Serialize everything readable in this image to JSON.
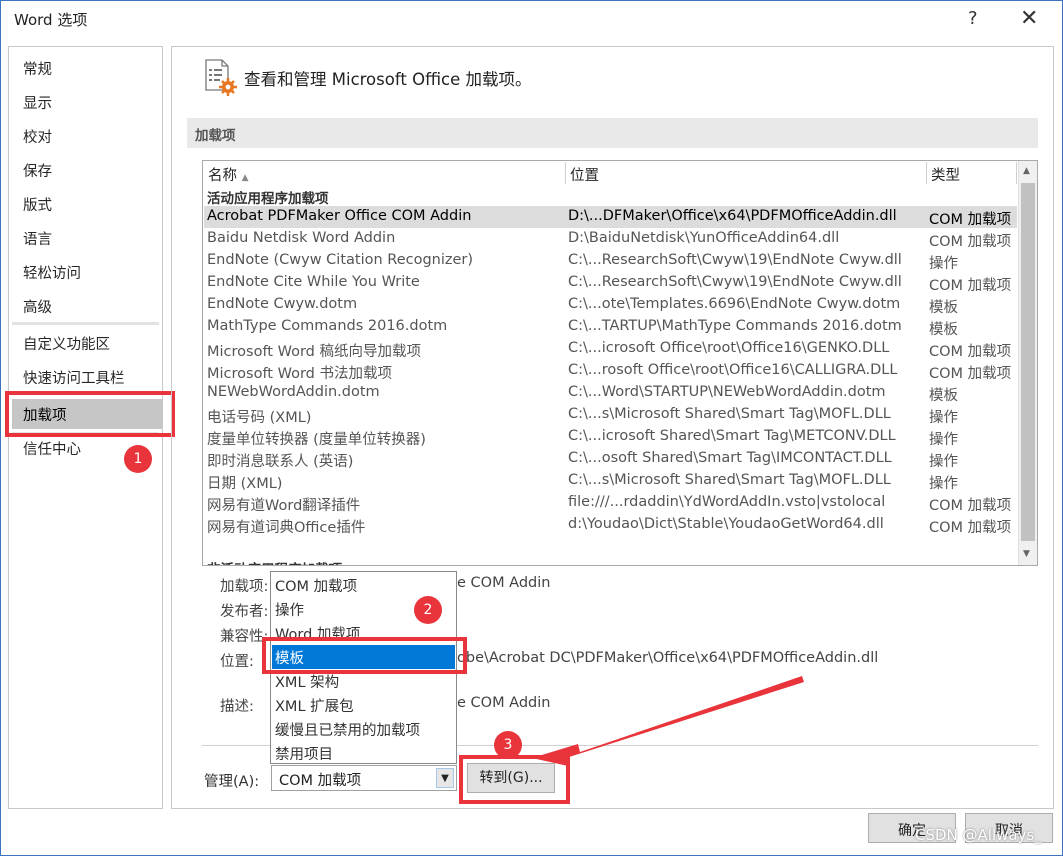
{
  "window": {
    "title": "Word 选项",
    "help": "?",
    "close": "✕"
  },
  "nav": {
    "items": [
      "常规",
      "显示",
      "校对",
      "保存",
      "版式",
      "语言",
      "轻松访问",
      "高级",
      "自定义功能区",
      "快速访问工具栏",
      "加载项",
      "信任中心"
    ],
    "selected": "加载项"
  },
  "header": {
    "heading": "查看和管理 Microsoft Office 加载项。"
  },
  "addins": {
    "section_title": "加载项",
    "columns": {
      "name": "名称",
      "location": "位置",
      "type": "类型"
    },
    "group_active": "活动应用程序加载项",
    "group_inactive": "非活动应用程序加载项",
    "rows": [
      {
        "name": "Acrobat PDFMaker Office COM Addin",
        "location": "D:\\...DFMaker\\Office\\x64\\PDFMOfficeAddin.dll",
        "type": "COM 加载项"
      },
      {
        "name": "Baidu Netdisk Word Addin",
        "location": "D:\\BaiduNetdisk\\YunOfficeAddin64.dll",
        "type": "COM 加载项"
      },
      {
        "name": "EndNote (Cwyw Citation Recognizer)",
        "location": "C:\\...ResearchSoft\\Cwyw\\19\\EndNote Cwyw.dll",
        "type": "操作"
      },
      {
        "name": "EndNote Cite While You Write",
        "location": "C:\\...ResearchSoft\\Cwyw\\19\\EndNote Cwyw.dll",
        "type": "COM 加载项"
      },
      {
        "name": "EndNote Cwyw.dotm",
        "location": "C:\\...ote\\Templates.6696\\EndNote Cwyw.dotm",
        "type": "模板"
      },
      {
        "name": "MathType Commands 2016.dotm",
        "location": "C:\\...TARTUP\\MathType Commands 2016.dotm",
        "type": "模板"
      },
      {
        "name": "Microsoft Word 稿纸向导加载项",
        "location": "C:\\...icrosoft Office\\root\\Office16\\GENKO.DLL",
        "type": "COM 加载项"
      },
      {
        "name": "Microsoft Word 书法加载项",
        "location": "C:\\...rosoft Office\\root\\Office16\\CALLIGRA.DLL",
        "type": "COM 加载项"
      },
      {
        "name": "NEWebWordAddin.dotm",
        "location": "C:\\...Word\\STARTUP\\NEWebWordAddin.dotm",
        "type": "模板"
      },
      {
        "name": "电话号码 (XML)",
        "location": "C:\\...s\\Microsoft Shared\\Smart Tag\\MOFL.DLL",
        "type": "操作"
      },
      {
        "name": "度量单位转换器 (度量单位转换器)",
        "location": "C:\\...icrosoft Shared\\Smart Tag\\METCONV.DLL",
        "type": "操作"
      },
      {
        "name": "即时消息联系人 (英语)",
        "location": "C:\\...osoft Shared\\Smart Tag\\IMCONTACT.DLL",
        "type": "操作"
      },
      {
        "name": "日期 (XML)",
        "location": "C:\\...s\\Microsoft Shared\\Smart Tag\\MOFL.DLL",
        "type": "操作"
      },
      {
        "name": "网易有道Word翻译插件",
        "location": "file:///...rdaddin\\YdWordAddIn.vsto|vstolocal",
        "type": "COM 加载项"
      },
      {
        "name": "网易有道词典Office插件",
        "location": "d:\\Youdao\\Dict\\Stable\\YoudaoGetWord64.dll",
        "type": "COM 加载项"
      }
    ]
  },
  "details": {
    "labels": {
      "addin": "加载项:",
      "publisher": "发布者:",
      "compat": "兼容性:",
      "location": "位置:",
      "desc": "描述:"
    },
    "addin_tail": "e COM Addin",
    "location_tail": "obe\\Acrobat DC\\PDFMaker\\Office\\x64\\PDFMOfficeAddin.dll",
    "desc_tail": "e COM Addin"
  },
  "manage": {
    "label": "管理(A):",
    "selected": "COM 加载项",
    "options": [
      "COM 加载项",
      "操作",
      "Word 加载项",
      "模板",
      "XML 架构",
      "XML 扩展包",
      "缓慢且已禁用的加载项",
      "禁用项目"
    ],
    "highlighted": "模板",
    "go_button": "转到(G)..."
  },
  "footer": {
    "ok": "确定",
    "cancel": "取消"
  },
  "annotations": {
    "badge1": "1",
    "badge2": "2",
    "badge3": "3",
    "color": "#e8343a"
  },
  "watermark": "CSDN @Allways_"
}
